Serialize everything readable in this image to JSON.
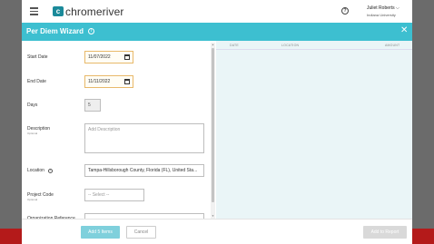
{
  "header": {
    "app_name": "chromeriver",
    "logo_mark": "c",
    "user_name": "Juliet Roberts",
    "user_org": "Indiana University",
    "icons": [
      "menu-icon",
      "help-icon",
      "chevron-down-icon"
    ]
  },
  "wizard": {
    "title": "Per Diem Wizard",
    "info": "i",
    "close": "✕"
  },
  "form": {
    "start_date_label": "Start Date",
    "start_date_value": "11/07/2022",
    "end_date_label": "End Date",
    "end_date_value": "11/11/2022",
    "days_label": "Days",
    "days_value": "5",
    "description_label": "Description",
    "description_sub": "Optional",
    "description_placeholder": "Add Description",
    "location_label": "Location",
    "location_value": "Tampa-Hillsborough County, Florida (FL), United Sta...",
    "project_code_label": "Project Code",
    "project_code_sub": "Optional",
    "project_code_placeholder": "-- Select --",
    "org_ref_label": "Organization Reference"
  },
  "table": {
    "columns": [
      "DATE",
      "LOCATION",
      "AMOUNT"
    ]
  },
  "footer": {
    "add_button": "Add 5 Items",
    "cancel_button": "Cancel",
    "add_report_button": "Add to Report"
  },
  "colors": {
    "accent": "#3dbfd0",
    "primary_button": "#7fd0dc",
    "disabled_button": "#d9d9d9",
    "table_bg": "#eaf5f7"
  }
}
